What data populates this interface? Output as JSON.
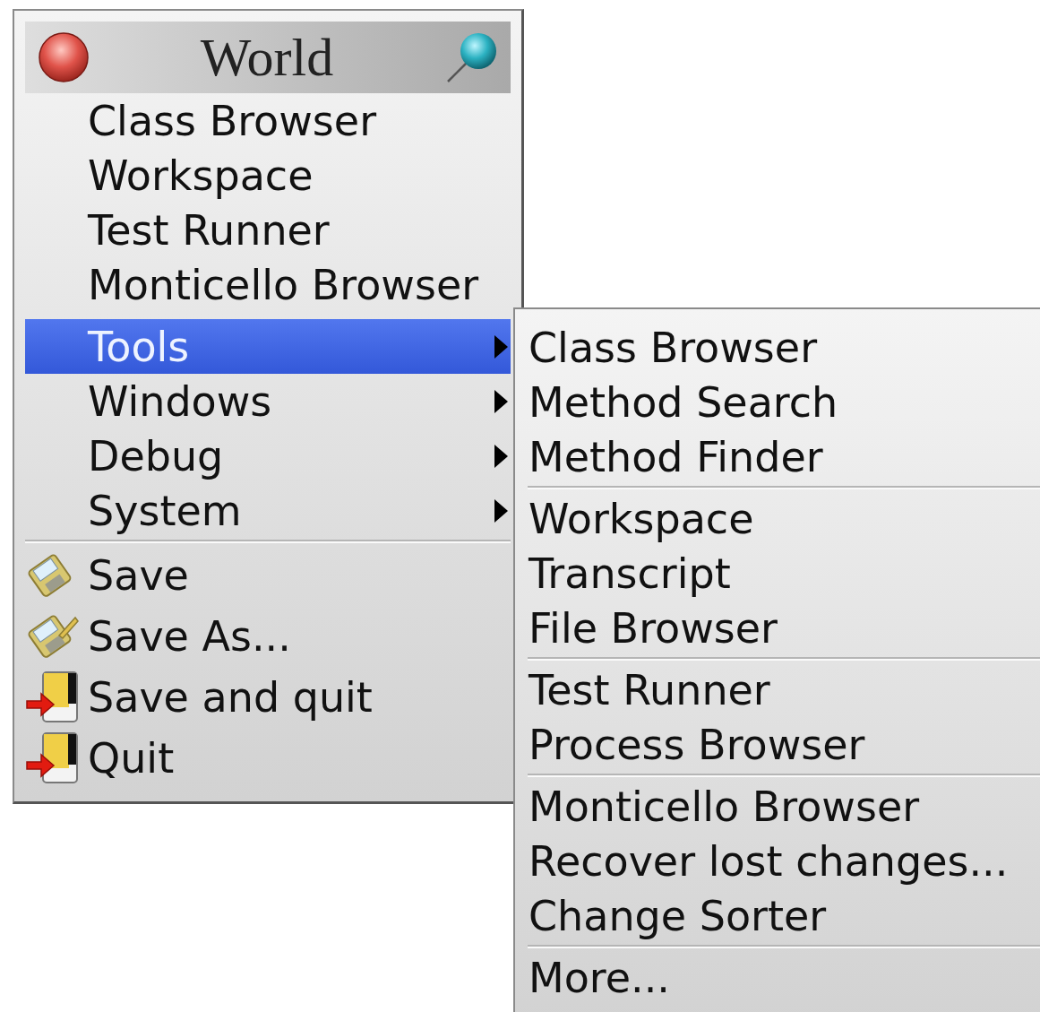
{
  "menu": {
    "title": "World",
    "items": [
      {
        "kind": "plain",
        "label": "Class Browser",
        "selected": false
      },
      {
        "kind": "plain",
        "label": "Workspace",
        "selected": false
      },
      {
        "kind": "plain",
        "label": "Test Runner",
        "selected": false
      },
      {
        "kind": "plain",
        "label": "Monticello Browser",
        "selected": false
      },
      {
        "kind": "submenu",
        "label": "Tools",
        "selected": true
      },
      {
        "kind": "submenu",
        "label": "Windows",
        "selected": false
      },
      {
        "kind": "submenu",
        "label": "Debug",
        "selected": false
      },
      {
        "kind": "submenu",
        "label": "System",
        "selected": false
      },
      {
        "kind": "separator"
      },
      {
        "kind": "floppy",
        "label": "Save",
        "selected": false
      },
      {
        "kind": "floppy-pen",
        "label": "Save As...",
        "selected": false
      },
      {
        "kind": "exit",
        "label": "Save and quit",
        "selected": false
      },
      {
        "kind": "exit",
        "label": "Quit",
        "selected": false
      }
    ]
  },
  "submenu": {
    "items": [
      {
        "kind": "plain",
        "label": "Class Browser",
        "selected": false
      },
      {
        "kind": "plain",
        "label": "Method Search",
        "selected": false
      },
      {
        "kind": "plain",
        "label": "Method Finder",
        "selected": false
      },
      {
        "kind": "separator"
      },
      {
        "kind": "plain",
        "label": "Workspace",
        "selected": false
      },
      {
        "kind": "plain",
        "label": "Transcript",
        "selected": false
      },
      {
        "kind": "plain",
        "label": "File Browser",
        "selected": false
      },
      {
        "kind": "separator"
      },
      {
        "kind": "plain",
        "label": "Test Runner",
        "selected": false
      },
      {
        "kind": "plain",
        "label": "Process Browser",
        "selected": false
      },
      {
        "kind": "separator"
      },
      {
        "kind": "plain",
        "label": "Monticello Browser",
        "selected": false
      },
      {
        "kind": "plain",
        "label": "Recover lost changes...",
        "selected": false
      },
      {
        "kind": "plain",
        "label": "Change Sorter",
        "selected": false
      },
      {
        "kind": "separator"
      },
      {
        "kind": "plain",
        "label": "More...",
        "selected": false
      }
    ]
  }
}
